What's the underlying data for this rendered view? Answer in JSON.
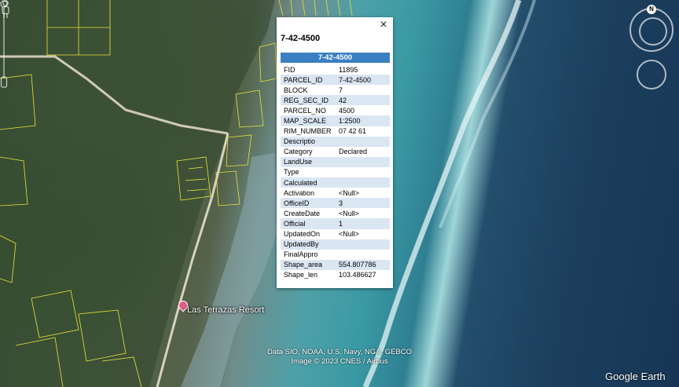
{
  "popup": {
    "title": "7-42-4500",
    "header": "7-42-4500",
    "close_label": "×",
    "rows": [
      {
        "key": "FID",
        "value": "11895"
      },
      {
        "key": "PARCEL_ID",
        "value": "7-42-4500"
      },
      {
        "key": "BLOCK",
        "value": "7"
      },
      {
        "key": "REG_SEC_ID",
        "value": "42"
      },
      {
        "key": "PARCEL_NO",
        "value": "4500"
      },
      {
        "key": "MAP_SCALE",
        "value": "1:2500"
      },
      {
        "key": "RIM_NUMBER",
        "value": "07 42 61"
      },
      {
        "key": "Descriptio",
        "value": ""
      },
      {
        "key": "Category",
        "value": "Declared"
      },
      {
        "key": "LandUse",
        "value": ""
      },
      {
        "key": "Type",
        "value": ""
      },
      {
        "key": "Calculated",
        "value": ""
      },
      {
        "key": "Activation",
        "value": "<Null>"
      },
      {
        "key": "OfficeID",
        "value": "3"
      },
      {
        "key": "CreateDate",
        "value": "<Null>"
      },
      {
        "key": "Official",
        "value": "1"
      },
      {
        "key": "UpdatedOn",
        "value": "<Null>"
      },
      {
        "key": "UpdatedBy",
        "value": ""
      },
      {
        "key": "FinalAppro",
        "value": ""
      },
      {
        "key": "Shape_area",
        "value": "554.807786"
      },
      {
        "key": "Shape_len",
        "value": "103.486627"
      }
    ]
  },
  "map": {
    "place_label": "Las Terrazas Resort",
    "credit_line1": "Data SIO, NOAA, U.S. Navy, NGA, GEBCO",
    "credit_line2": "Image © 2023 CNES / Airbus",
    "brand": "Google Earth",
    "compass_north": "N"
  },
  "colors": {
    "header_blue": "#3a7fc1",
    "row_alt": "#dbe6f3",
    "parcel_outline": "#e8e23a"
  }
}
